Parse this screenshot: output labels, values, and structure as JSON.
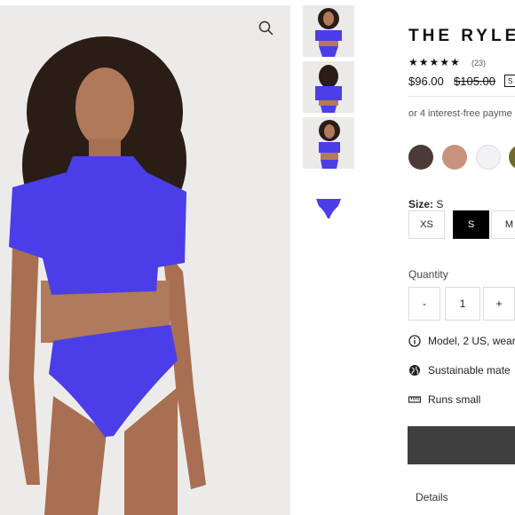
{
  "product": {
    "title": "THE RYLE",
    "stars": "★★★★★",
    "review_count": "(23)",
    "price": "$96.00",
    "compare_price": "$105.00",
    "badge": "S",
    "installments": "or 4 interest-free payme"
  },
  "swatches": [
    "#4b3a35",
    "#c9927c",
    "#f2f1f4",
    "#6f6a2e"
  ],
  "size": {
    "label": "Size:",
    "selected": "S",
    "options": [
      "XS",
      "S",
      "M"
    ]
  },
  "quantity": {
    "label": "Quantity",
    "minus": "-",
    "value": "1",
    "plus": "+"
  },
  "info": [
    {
      "icon": "info-icon",
      "text": "Model, 2 US, wear"
    },
    {
      "icon": "globe-icon",
      "text": "Sustainable mate"
    },
    {
      "icon": "ruler-icon",
      "text": "Runs small"
    }
  ],
  "details_label": "Details",
  "colors": {
    "accent": "#4b3ee8",
    "cart": "#3f3f3f",
    "selected_size": "#000000"
  }
}
